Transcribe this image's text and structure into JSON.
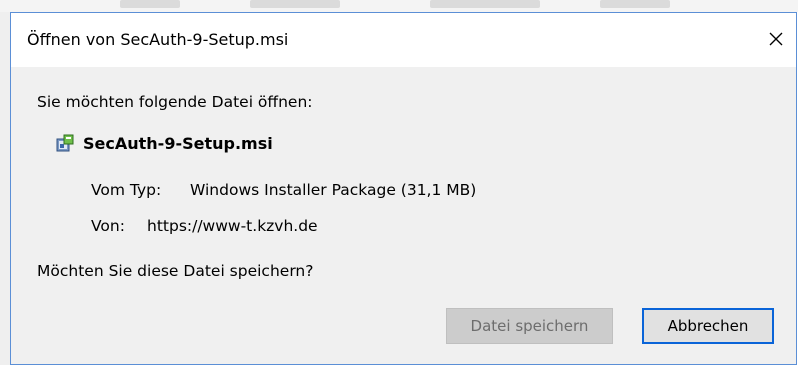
{
  "dialog": {
    "title": "Öffnen von SecAuth-9-Setup.msi",
    "close_icon": "close-icon",
    "prompt": "Sie möchten folgende Datei öffnen:",
    "file": {
      "icon": "installer-package-icon",
      "name": "SecAuth-9-Setup.msi"
    },
    "type_label": "Vom Typ:",
    "type_value": "Windows Installer Package (31,1 MB)",
    "from_label": "Von:",
    "from_value": "https://www-t.kzvh.de",
    "question": "Möchten Sie diese Datei speichern?",
    "buttons": {
      "save": "Datei speichern",
      "cancel": "Abbrechen"
    }
  },
  "colors": {
    "accent": "#0a64d8",
    "dialog_bg": "#f0f0f0",
    "disabled_bg": "#cccccc"
  }
}
